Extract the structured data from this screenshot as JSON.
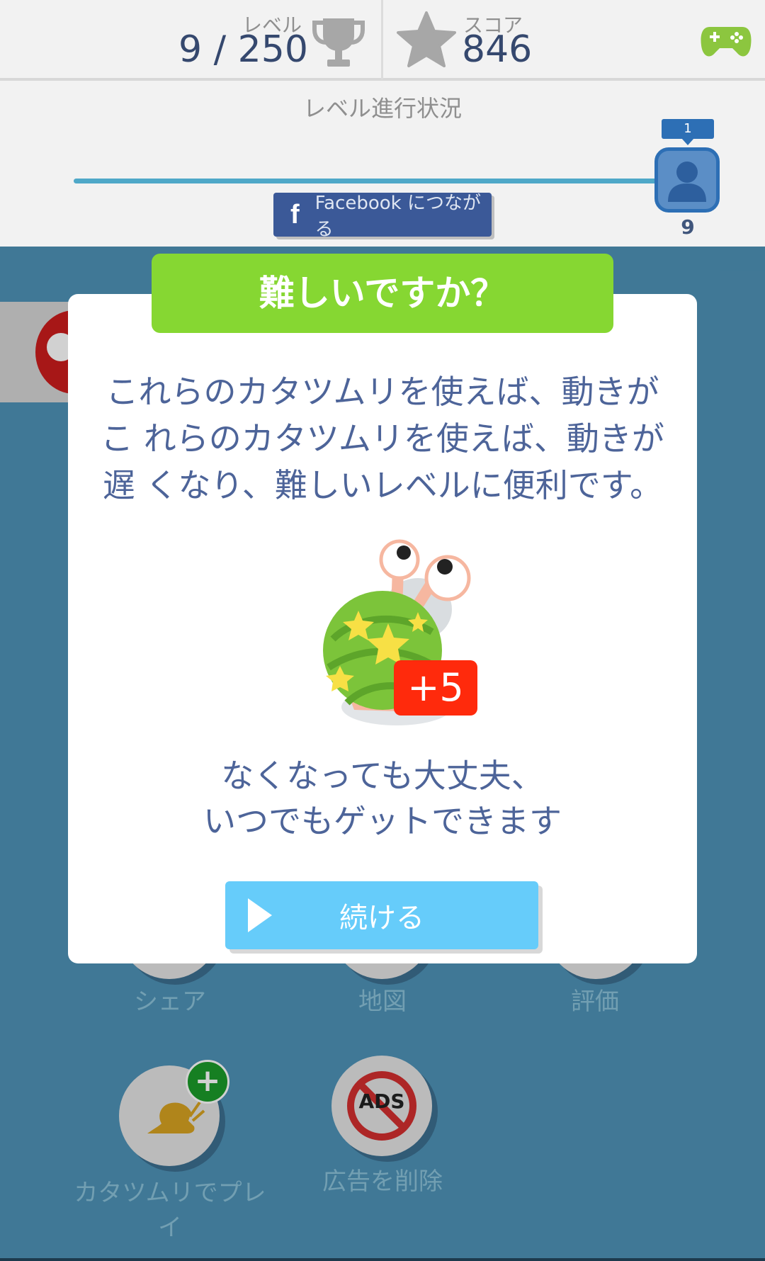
{
  "header": {
    "level_label": "レベル",
    "level_value": "9 / 250",
    "score_label": "スコア",
    "score_value": "846",
    "icons": {
      "level": "trophy-icon",
      "score": "star-icon",
      "games": "gamepad-icon"
    }
  },
  "progress": {
    "title": "レベル進行状況",
    "marker_tag": "1",
    "marker_level": "9",
    "facebook_button": "Facebook につながる",
    "facebook_icon_glyph": "f"
  },
  "menu": {
    "share": "シェア",
    "map": "地図",
    "rate": "評価",
    "play_snail": "カタツムリでプレイ",
    "remove_ads": "広告を削除",
    "ads_text": "ADS",
    "plus_glyph": "+"
  },
  "modal": {
    "title": "難しいですか？",
    "body_lines": [
      "これらのカタツムリを使えば、動きが",
      "こ れらのカタツムリを使えば、動きが",
      "遅 くなり、難しいレベルに便利です。"
    ],
    "badge": "+5",
    "footer_lines": [
      "なくなっても大丈夫、",
      "いつでもゲットできます"
    ],
    "continue_button": "続ける"
  },
  "colors": {
    "header_bg": "#f2f2f2",
    "modal_header_green": "#86d732",
    "continue_blue": "#66ccfa",
    "badge_red": "#ff2a0c",
    "text_navy": "#4d6499",
    "facebook_blue": "#3b5998"
  }
}
